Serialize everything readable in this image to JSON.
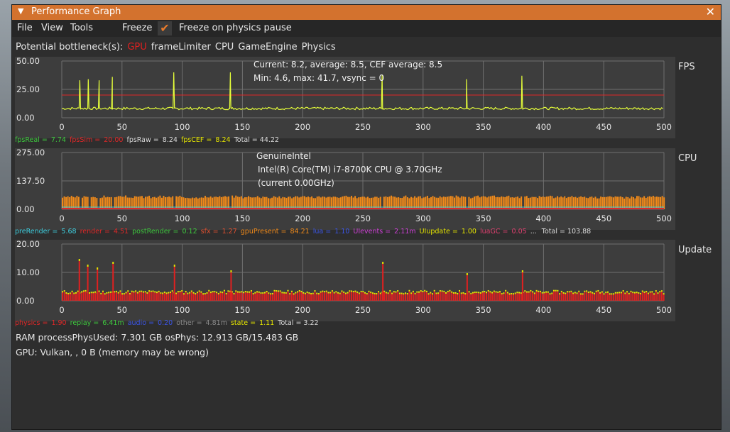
{
  "window": {
    "title": "Performance Graph"
  },
  "menu": {
    "file": "File",
    "view": "View",
    "tools": "Tools",
    "freeze": "Freeze",
    "freeze_physics": "Freeze on physics pause"
  },
  "bottleneck": {
    "label": "Potential bottleneck(s):",
    "items": [
      {
        "text": "GPU",
        "color": "#e02020"
      },
      {
        "text": "frameLimiter",
        "color": "#e6e6e6"
      },
      {
        "text": "CPU",
        "color": "#e6e6e6"
      },
      {
        "text": "GameEngine",
        "color": "#e6e6e6"
      },
      {
        "text": "Physics",
        "color": "#e6e6e6"
      }
    ]
  },
  "fps_panel": {
    "label": "FPS",
    "overlay_line1": "Current:  8.2, average:  8.5, CEF average:  8.5",
    "overlay_line2": "Min:  4.6, max: 41.7, vsync = 0",
    "legend": [
      {
        "name": "fpsReal =",
        "value": "7.74",
        "color": "#3ec83e"
      },
      {
        "name": "fpsSim =",
        "value": "20.00",
        "color": "#e02828"
      },
      {
        "name": "fpsRaw =",
        "value": "8.24",
        "color": "#dddddd"
      },
      {
        "name": "fpsCEF =",
        "value": "8.24",
        "color": "#e6e600"
      }
    ],
    "total": "Total = 44.22"
  },
  "cpu_panel": {
    "label": "CPU",
    "overlay_line1": "GenuineIntel",
    "overlay_line2": "Intel(R) Core(TM) i7-8700K CPU @ 3.70GHz",
    "overlay_line3": "(current 0.00GHz)",
    "legend": [
      {
        "name": "preRender =",
        "value": "5.68",
        "color": "#3fd0e0"
      },
      {
        "name": "render =",
        "value": "4.51",
        "color": "#e02828"
      },
      {
        "name": "postRender =",
        "value": "0.12",
        "color": "#3ec83e"
      },
      {
        "name": "sfx =",
        "value": "1.27",
        "color": "#e05030"
      },
      {
        "name": "gpuPresent =",
        "value": "84.21",
        "color": "#f08a1a"
      },
      {
        "name": "lua =",
        "value": "1.10",
        "color": "#3b55e8"
      },
      {
        "name": "UIevents =",
        "value": "2.11m",
        "color": "#d040d8"
      },
      {
        "name": "UIupdate =",
        "value": "1.00",
        "color": "#e6e600"
      },
      {
        "name": "luaGC =",
        "value": "0.05",
        "color": "#e04070"
      },
      {
        "name": "...",
        "value": "",
        "color": "#dddddd"
      }
    ],
    "total": "Total = 103.88"
  },
  "update_panel": {
    "label": "Update",
    "legend": [
      {
        "name": "physics =",
        "value": "1.90",
        "color": "#e02828"
      },
      {
        "name": "replay =",
        "value": "6.41m",
        "color": "#3ec83e"
      },
      {
        "name": "audio =",
        "value": "0.20",
        "color": "#3b55e8"
      },
      {
        "name": "other =",
        "value": "4.81m",
        "color": "#8a8a8a"
      },
      {
        "name": "state =",
        "value": "1.11",
        "color": "#e6e600"
      }
    ],
    "total": "Total = 3.22"
  },
  "ram_text": "RAM  processPhysUsed: 7.301 GB  osPhys: 12.913 GB/15.483 GB",
  "gpu_text": "GPU: Vulkan, , 0 B (memory may be wrong)",
  "chart_data": [
    {
      "type": "line",
      "name": "FPS",
      "xlim": [
        0,
        500
      ],
      "ylim": [
        0,
        50
      ],
      "x_ticks": [
        "0",
        "50",
        "100",
        "150",
        "200",
        "250",
        "300",
        "350",
        "400",
        "450",
        "500"
      ],
      "y_ticks": [
        "50.00",
        "25.00",
        "0.00"
      ],
      "baseline": 8.2,
      "reference_line": 20,
      "spikes": [
        {
          "x": 15,
          "y": 33
        },
        {
          "x": 22,
          "y": 34
        },
        {
          "x": 31,
          "y": 33
        },
        {
          "x": 42,
          "y": 36
        },
        {
          "x": 93,
          "y": 40
        },
        {
          "x": 140,
          "y": 40
        },
        {
          "x": 266,
          "y": 38
        },
        {
          "x": 336,
          "y": 34
        },
        {
          "x": 382,
          "y": 37
        }
      ]
    },
    {
      "type": "area",
      "name": "CPU",
      "xlim": [
        0,
        500
      ],
      "ylim": [
        0,
        275
      ],
      "x_ticks": [
        "0",
        "50",
        "100",
        "150",
        "200",
        "250",
        "300",
        "350",
        "400",
        "450",
        "500"
      ],
      "y_ticks": [
        "275.00",
        "137.50",
        "0.00"
      ],
      "series": [
        {
          "name": "gpuPresent",
          "value": 84.21
        },
        {
          "name": "preRender",
          "value": 5.68
        },
        {
          "name": "render",
          "value": 4.51
        }
      ],
      "total": 103.88
    },
    {
      "type": "bar",
      "name": "Update",
      "xlim": [
        0,
        500
      ],
      "ylim": [
        0,
        20
      ],
      "x_ticks": [
        "0",
        "50",
        "100",
        "150",
        "200",
        "250",
        "300",
        "350",
        "400",
        "450",
        "500"
      ],
      "y_ticks": [
        "20.00",
        "10.00",
        "0.00"
      ],
      "baseline": 2.5,
      "spikes": [
        {
          "x": 14,
          "y": 14
        },
        {
          "x": 21,
          "y": 12
        },
        {
          "x": 29,
          "y": 11
        },
        {
          "x": 42,
          "y": 13
        },
        {
          "x": 93,
          "y": 12
        },
        {
          "x": 140,
          "y": 10
        },
        {
          "x": 266,
          "y": 13
        },
        {
          "x": 336,
          "y": 9
        },
        {
          "x": 382,
          "y": 10
        }
      ]
    }
  ]
}
